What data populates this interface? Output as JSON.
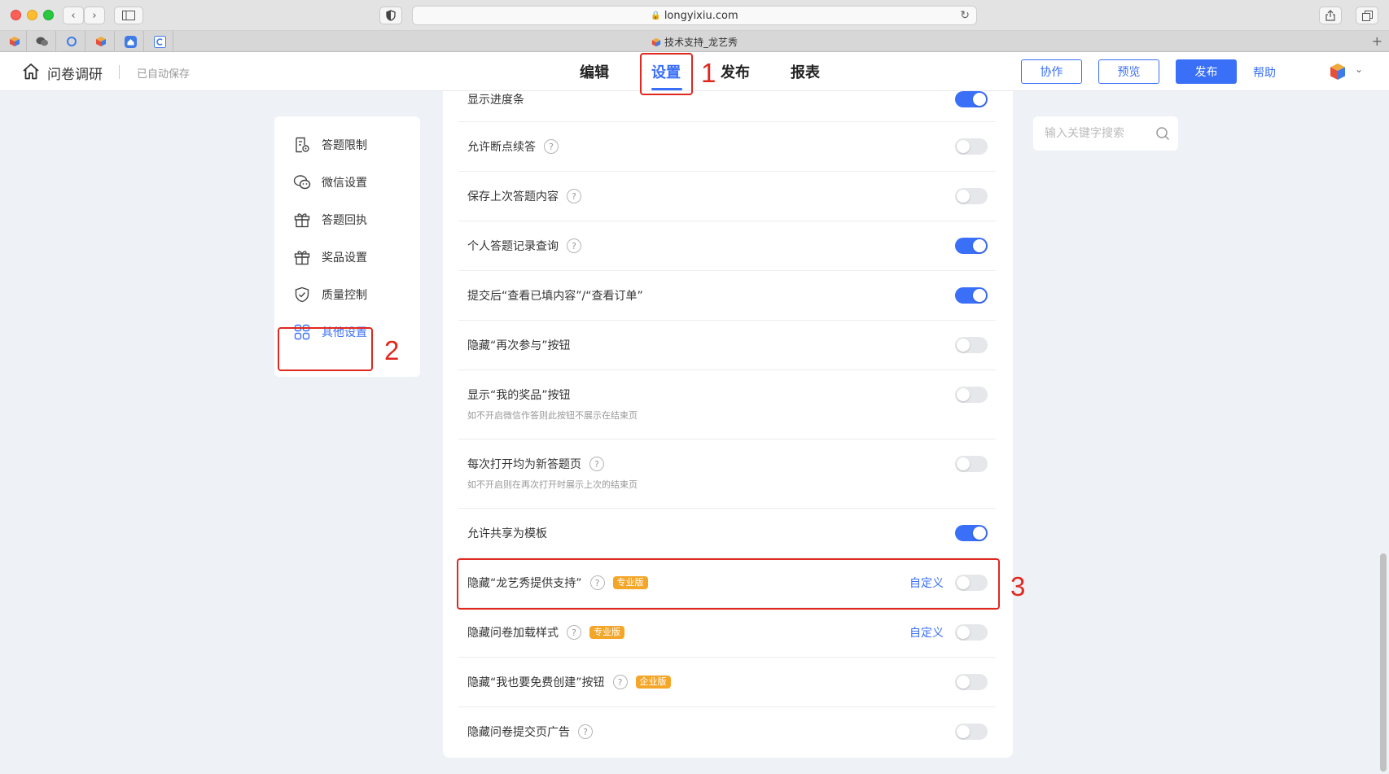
{
  "browser": {
    "url": "longyixiu.com",
    "tab_title": "技术支持_龙艺秀"
  },
  "header": {
    "app_title": "问卷调研",
    "autosave": "已自动保存",
    "tabs": [
      {
        "label": "编辑",
        "active": false
      },
      {
        "label": "设置",
        "active": true
      },
      {
        "label": "发布",
        "active": false
      },
      {
        "label": "报表",
        "active": false
      }
    ],
    "buttons": {
      "collaborate": "协作",
      "preview": "预览",
      "publish": "发布"
    },
    "help": "帮助"
  },
  "sidebar": {
    "items": [
      {
        "label": "答题限制",
        "icon": "document-settings-icon",
        "active": false
      },
      {
        "label": "微信设置",
        "icon": "wechat-icon",
        "active": false
      },
      {
        "label": "答题回执",
        "icon": "gift-icon",
        "active": false
      },
      {
        "label": "奖品设置",
        "icon": "gift-icon",
        "active": false
      },
      {
        "label": "质量控制",
        "icon": "shield-check-icon",
        "active": false
      },
      {
        "label": "其他设置",
        "icon": "grid-icon",
        "active": true
      }
    ]
  },
  "settings": [
    {
      "label": "显示进度条",
      "help": false,
      "on": true
    },
    {
      "label": "允许断点续答",
      "help": true,
      "on": false
    },
    {
      "label": "保存上次答题内容",
      "help": true,
      "on": false
    },
    {
      "label": "个人答题记录查询",
      "help": true,
      "on": true
    },
    {
      "label": "提交后“查看已填内容”/“查看订单”",
      "help": false,
      "on": true
    },
    {
      "label": "隐藏“再次参与”按钮",
      "help": false,
      "on": false
    },
    {
      "label": "显示“我的奖品”按钮",
      "hint": "如不开启微信作答则此按钮不展示在结束页",
      "help": false,
      "on": false
    },
    {
      "label": "每次打开均为新答题页",
      "hint": "如不开启则在再次打开时展示上次的结束页",
      "help": true,
      "on": false
    },
    {
      "label": "允许共享为模板",
      "help": false,
      "on": true
    },
    {
      "label": "隐藏“龙艺秀提供支持”",
      "help": true,
      "badge": "专业版",
      "custom": "自定义",
      "on": false
    },
    {
      "label": "隐藏问卷加载样式",
      "help": true,
      "badge": "专业版",
      "custom": "自定义",
      "on": false
    },
    {
      "label": "隐藏“我也要免费创建”按钮",
      "help": true,
      "badge": "企业版",
      "on": false
    },
    {
      "label": "隐藏问卷提交页广告",
      "help": true,
      "on": false
    }
  ],
  "search": {
    "placeholder": "输入关键字搜索"
  },
  "annotations": {
    "one": "1",
    "two": "2",
    "three": "3"
  },
  "colors": {
    "accent": "#3a6ff7",
    "badge": "#f4a629",
    "annotation": "#e0281f"
  }
}
